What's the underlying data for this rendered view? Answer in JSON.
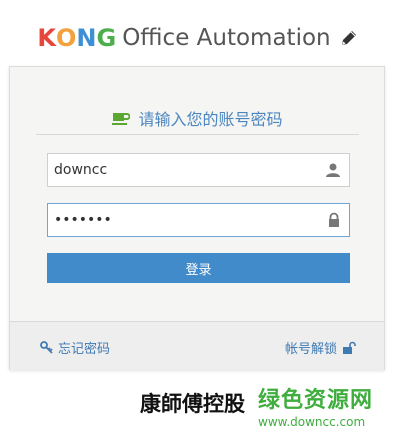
{
  "header": {
    "logo_letters": [
      "K",
      "O",
      "N",
      "G"
    ],
    "logo_colors": [
      "#e8453c",
      "#f2a13c",
      "#3d8fd6",
      "#4cae4c"
    ],
    "app_title": "Office Automation",
    "edit_icon": "pencil-icon"
  },
  "login": {
    "heading": "请输入您的账号密码",
    "heading_icon": "coffee-cup-icon",
    "username_value": "downcc",
    "username_icon": "user-icon",
    "password_value": "•••••••",
    "password_icon": "lock-icon",
    "submit_label": "登录",
    "accent_color": "#428bca"
  },
  "footer": {
    "forgot_label": "忘记密码",
    "forgot_icon": "key-icon",
    "unlock_label": "帐号解锁",
    "unlock_icon": "unlock-icon"
  },
  "branding": {
    "company": "康師傅控股"
  },
  "watermark": {
    "name": "绿色资源网",
    "url": "www.downcc.com"
  }
}
